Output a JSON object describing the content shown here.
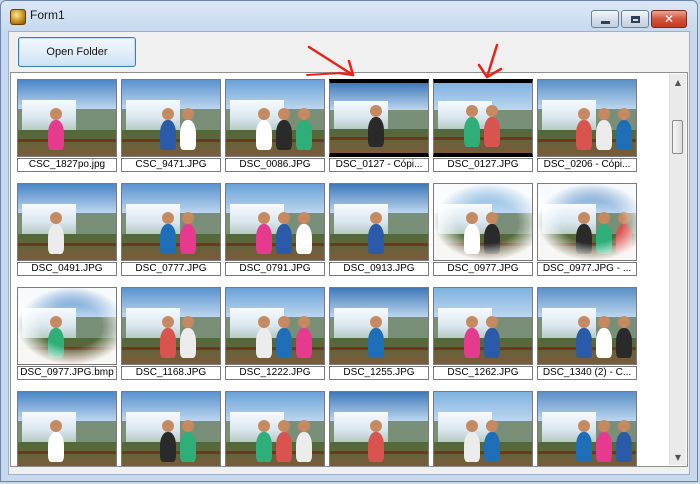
{
  "window": {
    "title": "Form1",
    "icon": "app-icon",
    "controls": [
      "minimize-icon",
      "maximize-icon",
      "close-icon"
    ]
  },
  "toolbar": {
    "open_folder_label": "Open Folder"
  },
  "thumbnails": [
    {
      "caption": "CSC_1827po.jpg"
    },
    {
      "caption": "CSC_9471.JPG"
    },
    {
      "caption": "DSC_0086.JPG"
    },
    {
      "caption": "DSC_0127 - Cópi..."
    },
    {
      "caption": "DSC_0127.JPG"
    },
    {
      "caption": "DSC_0206 - Cópi..."
    },
    {
      "caption": "DSC_0491.JPG"
    },
    {
      "caption": "DSC_0777.JPG"
    },
    {
      "caption": "DSC_0791.JPG"
    },
    {
      "caption": "DSC_0913.JPG"
    },
    {
      "caption": "DSC_0977.JPG"
    },
    {
      "caption": "DSC_0977.JPG - ..."
    },
    {
      "caption": "DSC_0977.JPG.bmp"
    },
    {
      "caption": "DSC_1168.JPG"
    },
    {
      "caption": "DSC_1222.JPG"
    },
    {
      "caption": "DSC_1255.JPG"
    },
    {
      "caption": "DSC_1262.JPG"
    },
    {
      "caption": "DSC_1340 (2) - C..."
    },
    {
      "caption": ""
    },
    {
      "caption": ""
    },
    {
      "caption": ""
    },
    {
      "caption": ""
    },
    {
      "caption": ""
    },
    {
      "caption": ""
    }
  ],
  "colors": {
    "annotation_arrow": "#e8231a",
    "selection_border": "#3c7fb1"
  }
}
